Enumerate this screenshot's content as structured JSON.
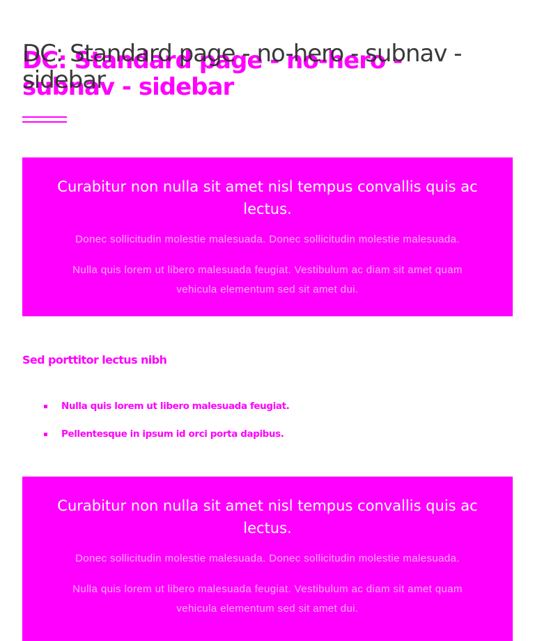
{
  "page": {
    "title": "DC: Standard page - no-hero - subnav - sidebar"
  },
  "callouts": [
    {
      "heading": "Curabitur non nulla sit amet nisl tempus convallis quis ac lectus.",
      "paragraphs": [
        "Donec sollicitudin molestie malesuada. Donec sollicitudin molestie malesuada.",
        "Nulla quis lorem ut libero malesuada feugiat. Vestibulum ac diam sit amet quam vehicula elementum sed sit amet dui."
      ]
    },
    {
      "heading": "Curabitur non nulla sit amet nisl tempus convallis quis ac lectus.",
      "paragraphs": [
        "Donec sollicitudin molestie malesuada. Donec sollicitudin molestie malesuada.",
        "Nulla quis lorem ut libero malesuada feugiat. Vestibulum ac diam sit amet quam vehicula elementum sed sit amet dui."
      ]
    }
  ],
  "section": {
    "heading": "Sed porttitor lectus nibh",
    "bullets": [
      "Nulla quis lorem ut libero malesuada feugiat.",
      "Pellentesque in ipsum id orci porta dapibus."
    ]
  },
  "colors": {
    "accent": "#ff00ff",
    "title_text": "#2a2a2a",
    "callout_heading": "#ffffff"
  }
}
